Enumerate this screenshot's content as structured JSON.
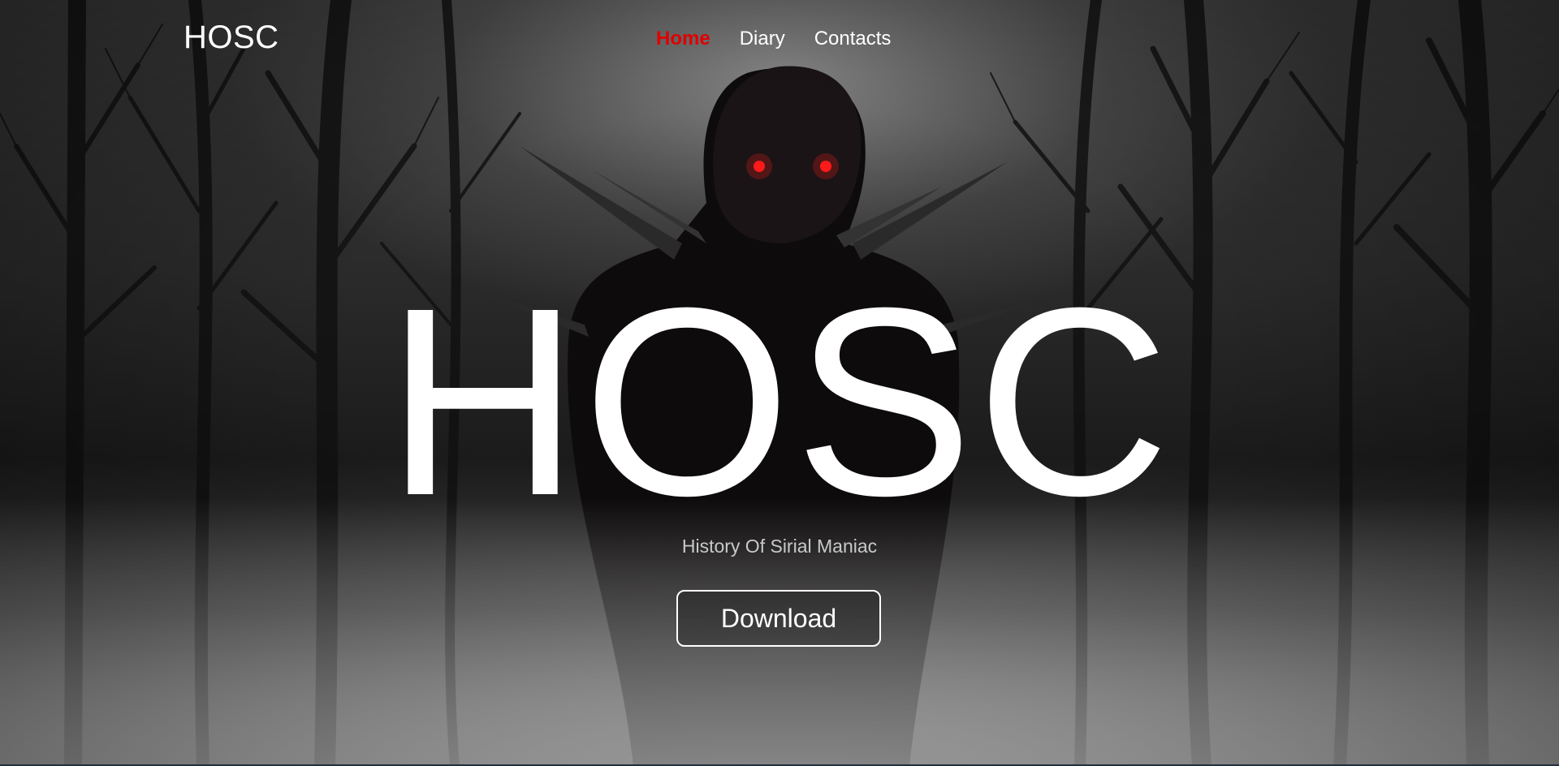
{
  "nav": {
    "logo": "HOSC",
    "links": [
      {
        "label": "Home",
        "active": true
      },
      {
        "label": "Diary",
        "active": false
      },
      {
        "label": "Contacts",
        "active": false
      }
    ],
    "active_color": "#e00000"
  },
  "hero": {
    "title": "HOSC",
    "subtitle": "History Of Sirial Maniac",
    "button_label": "Download"
  },
  "colors": {
    "eye": "#ff1a1a",
    "text": "#ffffff"
  }
}
